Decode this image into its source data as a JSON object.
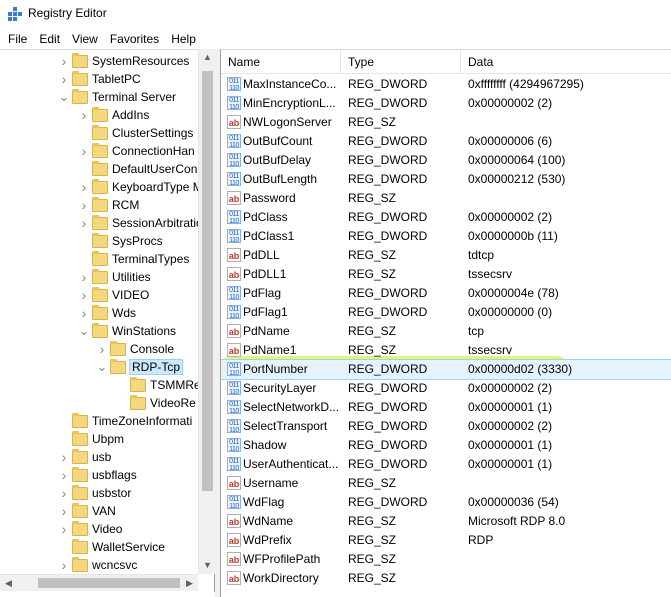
{
  "window": {
    "title": "Registry Editor",
    "icon": "registry-icon"
  },
  "menu": [
    "File",
    "Edit",
    "View",
    "Favorites",
    "Help"
  ],
  "tree": [
    {
      "label": "SystemResources",
      "level": 0,
      "chev": "right"
    },
    {
      "label": "TabletPC",
      "level": 0,
      "chev": "right"
    },
    {
      "label": "Terminal Server",
      "level": 0,
      "chev": "down"
    },
    {
      "label": "AddIns",
      "level": 1,
      "chev": "right"
    },
    {
      "label": "ClusterSettings",
      "level": 1,
      "chev": ""
    },
    {
      "label": "ConnectionHan",
      "level": 1,
      "chev": "right"
    },
    {
      "label": "DefaultUserCon",
      "level": 1,
      "chev": ""
    },
    {
      "label": "KeyboardType M",
      "level": 1,
      "chev": "right"
    },
    {
      "label": "RCM",
      "level": 1,
      "chev": "right"
    },
    {
      "label": "SessionArbitratio",
      "level": 1,
      "chev": "right"
    },
    {
      "label": "SysProcs",
      "level": 1,
      "chev": ""
    },
    {
      "label": "TerminalTypes",
      "level": 1,
      "chev": ""
    },
    {
      "label": "Utilities",
      "level": 1,
      "chev": "right"
    },
    {
      "label": "VIDEO",
      "level": 1,
      "chev": "right"
    },
    {
      "label": "Wds",
      "level": 1,
      "chev": "right"
    },
    {
      "label": "WinStations",
      "level": 1,
      "chev": "down"
    },
    {
      "label": "Console",
      "level": 2,
      "chev": "right"
    },
    {
      "label": "RDP-Tcp",
      "level": 2,
      "chev": "down",
      "selected": true
    },
    {
      "label": "TSMMRe",
      "level": 3,
      "chev": ""
    },
    {
      "label": "VideoRe",
      "level": 3,
      "chev": ""
    },
    {
      "label": "TimeZoneInformati",
      "level": 0,
      "chev": ""
    },
    {
      "label": "Ubpm",
      "level": 0,
      "chev": ""
    },
    {
      "label": "usb",
      "level": 0,
      "chev": "right"
    },
    {
      "label": "usbflags",
      "level": 0,
      "chev": "right"
    },
    {
      "label": "usbstor",
      "level": 0,
      "chev": "right"
    },
    {
      "label": "VAN",
      "level": 0,
      "chev": "right"
    },
    {
      "label": "Video",
      "level": 0,
      "chev": "right"
    },
    {
      "label": "WalletService",
      "level": 0,
      "chev": ""
    },
    {
      "label": "wcncsvc",
      "level": 0,
      "chev": "right"
    }
  ],
  "columns": {
    "name": "Name",
    "type": "Type",
    "data": "Data"
  },
  "values": [
    {
      "name": "MaxInstanceCo...",
      "type": "REG_DWORD",
      "data": "0xffffffff (4294967295)",
      "icon": "binary"
    },
    {
      "name": "MinEncryptionL...",
      "type": "REG_DWORD",
      "data": "0x00000002 (2)",
      "icon": "binary"
    },
    {
      "name": "NWLogonServer",
      "type": "REG_SZ",
      "data": "",
      "icon": "string"
    },
    {
      "name": "OutBufCount",
      "type": "REG_DWORD",
      "data": "0x00000006 (6)",
      "icon": "binary"
    },
    {
      "name": "OutBufDelay",
      "type": "REG_DWORD",
      "data": "0x00000064 (100)",
      "icon": "binary"
    },
    {
      "name": "OutBufLength",
      "type": "REG_DWORD",
      "data": "0x00000212 (530)",
      "icon": "binary"
    },
    {
      "name": "Password",
      "type": "REG_SZ",
      "data": "",
      "icon": "string"
    },
    {
      "name": "PdClass",
      "type": "REG_DWORD",
      "data": "0x00000002 (2)",
      "icon": "binary"
    },
    {
      "name": "PdClass1",
      "type": "REG_DWORD",
      "data": "0x0000000b (11)",
      "icon": "binary"
    },
    {
      "name": "PdDLL",
      "type": "REG_SZ",
      "data": "tdtcp",
      "icon": "string"
    },
    {
      "name": "PdDLL1",
      "type": "REG_SZ",
      "data": "tssecsrv",
      "icon": "string"
    },
    {
      "name": "PdFlag",
      "type": "REG_DWORD",
      "data": "0x0000004e (78)",
      "icon": "binary"
    },
    {
      "name": "PdFlag1",
      "type": "REG_DWORD",
      "data": "0x00000000 (0)",
      "icon": "binary"
    },
    {
      "name": "PdName",
      "type": "REG_SZ",
      "data": "tcp",
      "icon": "string"
    },
    {
      "name": "PdName1",
      "type": "REG_SZ",
      "data": "tssecsrv",
      "icon": "string"
    },
    {
      "name": "PortNumber",
      "type": "REG_DWORD",
      "data": "0x00000d02 (3330)",
      "icon": "binary",
      "selected": true
    },
    {
      "name": "SecurityLayer",
      "type": "REG_DWORD",
      "data": "0x00000002 (2)",
      "icon": "binary"
    },
    {
      "name": "SelectNetworkD...",
      "type": "REG_DWORD",
      "data": "0x00000001 (1)",
      "icon": "binary"
    },
    {
      "name": "SelectTransport",
      "type": "REG_DWORD",
      "data": "0x00000002 (2)",
      "icon": "binary"
    },
    {
      "name": "Shadow",
      "type": "REG_DWORD",
      "data": "0x00000001 (1)",
      "icon": "binary"
    },
    {
      "name": "UserAuthenticat...",
      "type": "REG_DWORD",
      "data": "0x00000001 (1)",
      "icon": "binary"
    },
    {
      "name": "Username",
      "type": "REG_SZ",
      "data": "",
      "icon": "string"
    },
    {
      "name": "WdFlag",
      "type": "REG_DWORD",
      "data": "0x00000036 (54)",
      "icon": "binary"
    },
    {
      "name": "WdName",
      "type": "REG_SZ",
      "data": "Microsoft RDP 8.0",
      "icon": "string"
    },
    {
      "name": "WdPrefix",
      "type": "REG_SZ",
      "data": "RDP",
      "icon": "string"
    },
    {
      "name": "WFProfilePath",
      "type": "REG_SZ",
      "data": "",
      "icon": "string"
    },
    {
      "name": "WorkDirectory",
      "type": "REG_SZ",
      "data": "",
      "icon": "string"
    }
  ],
  "colors": {
    "highlight": "#dcf028",
    "selection": "#cce8ff",
    "folder": "#f5d77d"
  }
}
